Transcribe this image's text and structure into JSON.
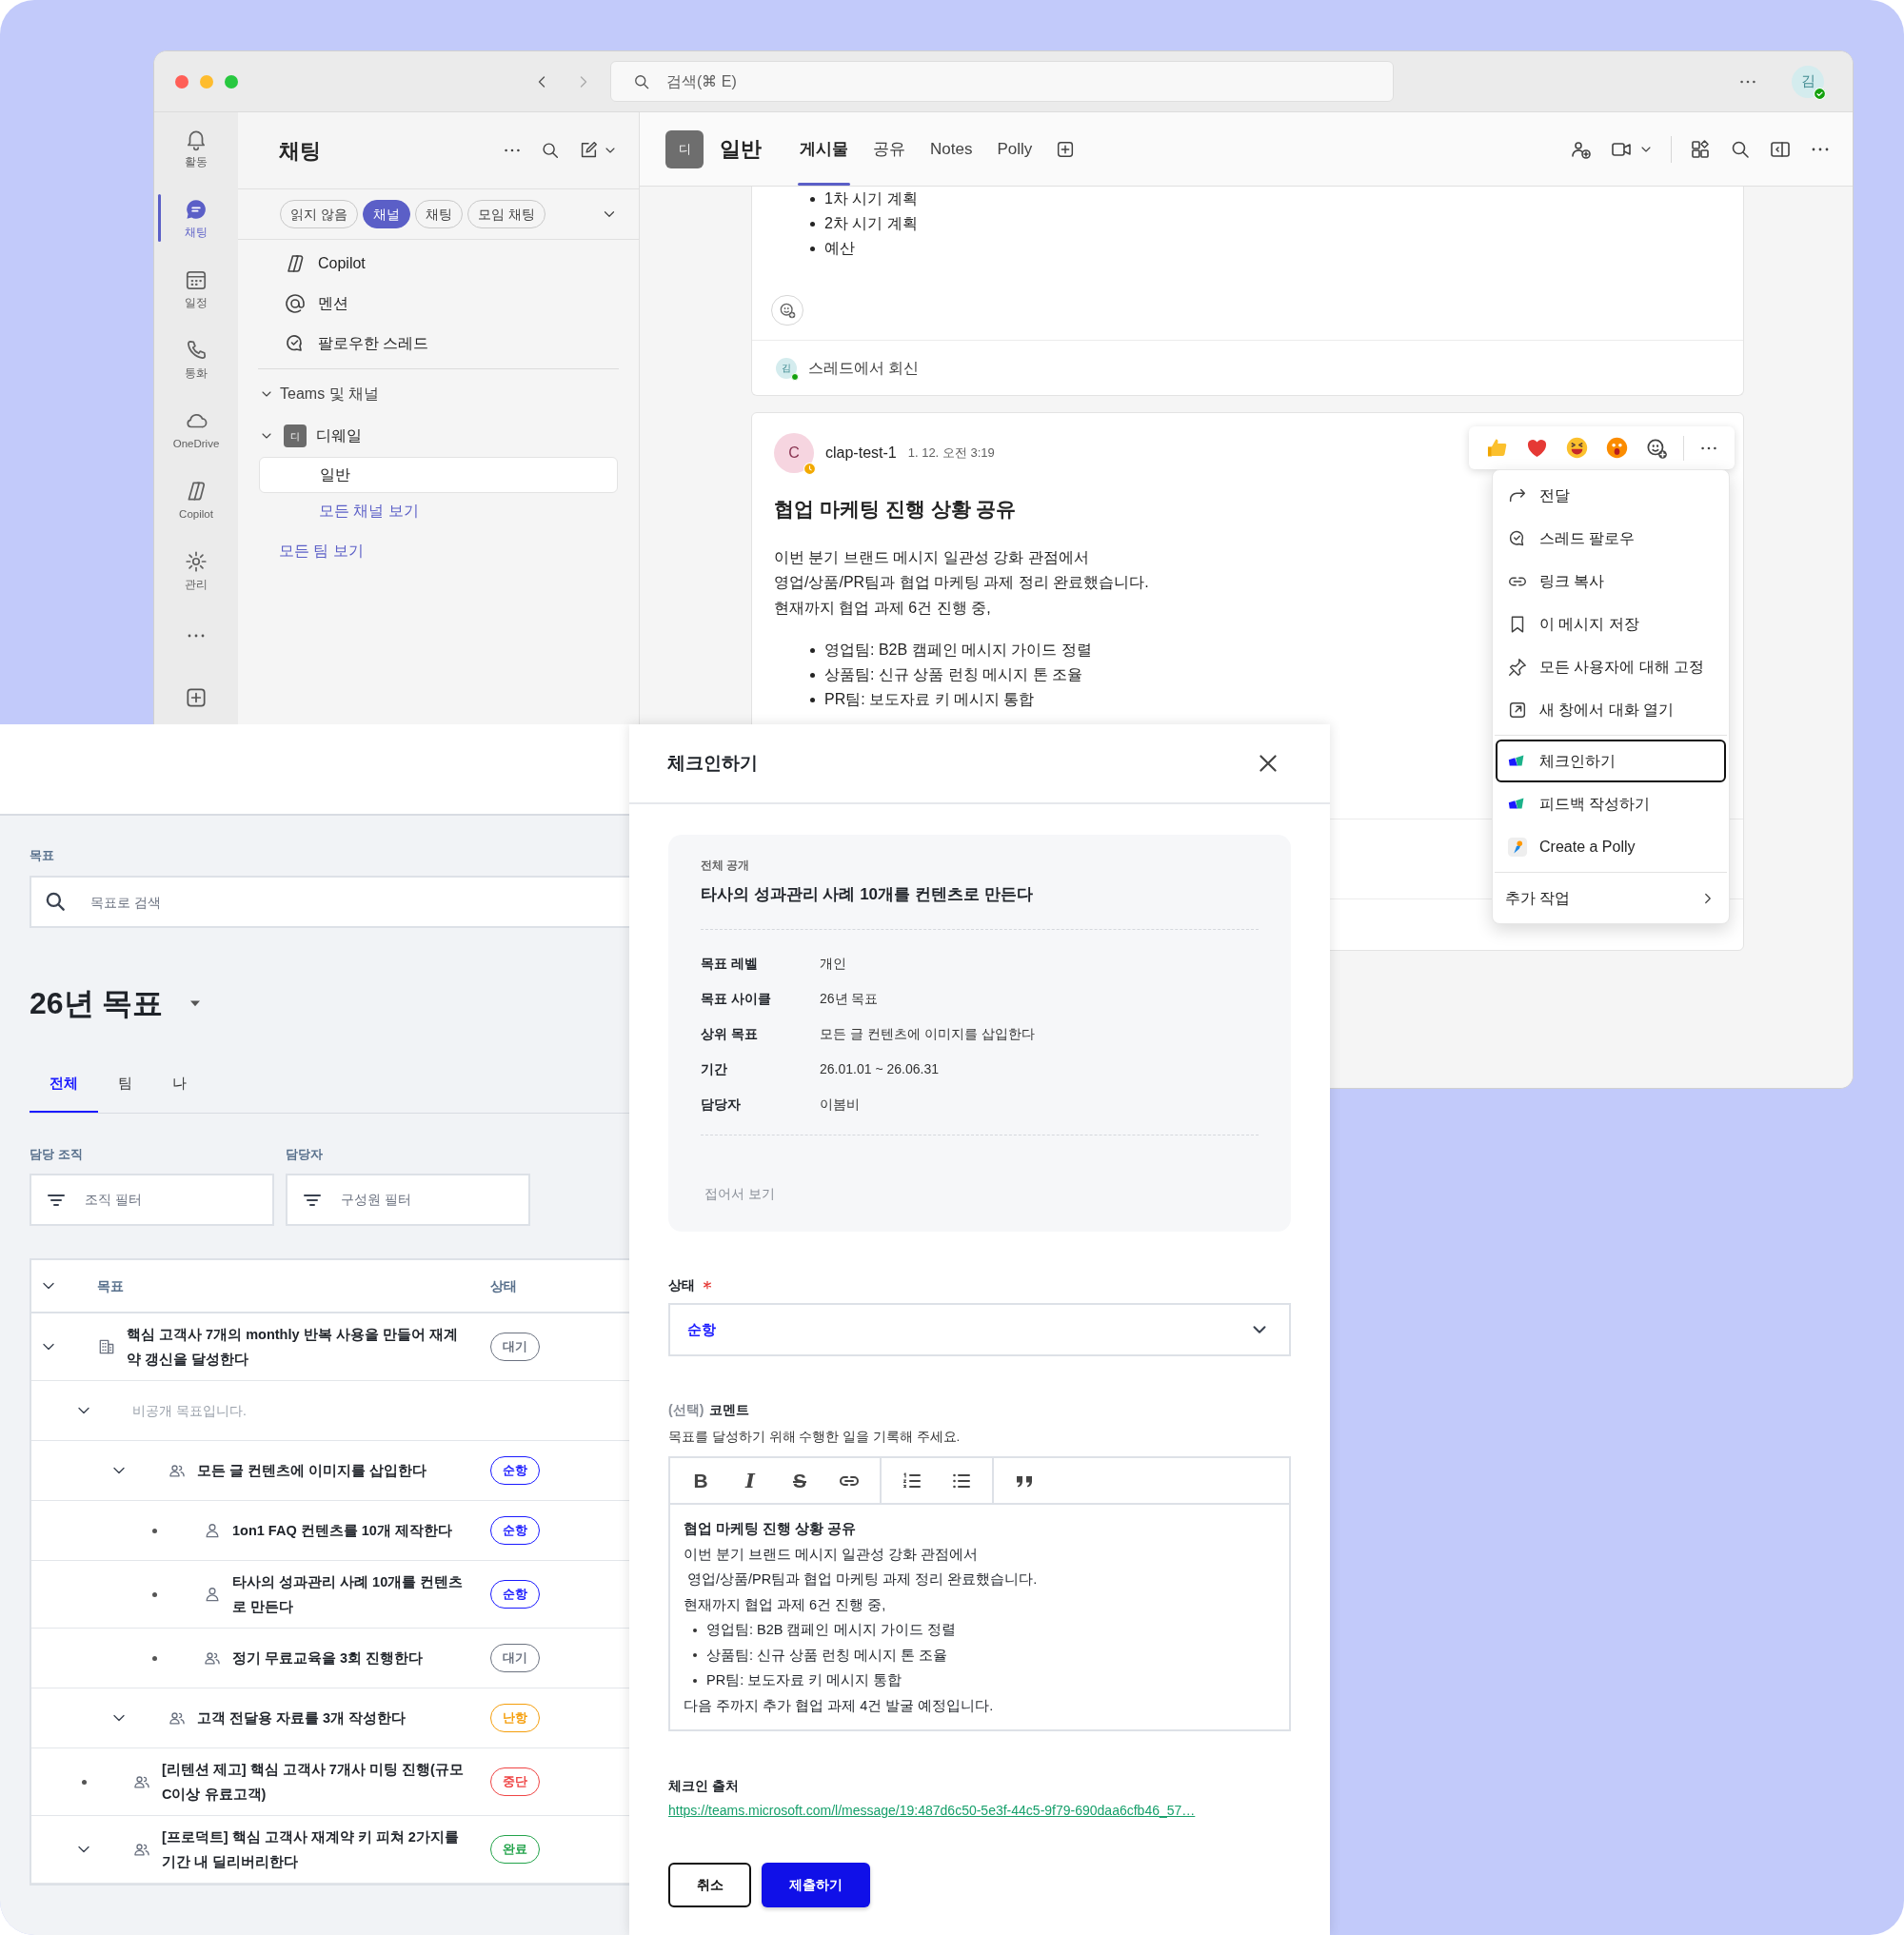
{
  "teams": {
    "search_placeholder": "검색(⌘ E)",
    "user_initial": "김",
    "rail": [
      {
        "label": "활동",
        "selected": false
      },
      {
        "label": "채팅",
        "selected": true
      },
      {
        "label": "일정",
        "selected": false
      },
      {
        "label": "통화",
        "selected": false
      },
      {
        "label": "OneDrive",
        "selected": false
      },
      {
        "label": "Copilot",
        "selected": false
      },
      {
        "label": "관리",
        "selected": false
      }
    ],
    "chat_panel": {
      "title": "채팅",
      "filters": [
        {
          "label": "읽지 않음",
          "selected": false
        },
        {
          "label": "채널",
          "selected": true
        },
        {
          "label": "채팅",
          "selected": false
        },
        {
          "label": "모임 채팅",
          "selected": false
        }
      ],
      "shortcuts": [
        "Copilot",
        "멘션",
        "팔로우한 스레드"
      ],
      "section": {
        "label": "Teams 및 채널",
        "expanded": true
      },
      "team": {
        "initial": "디",
        "name": "디웨일",
        "expanded": true,
        "channels": [
          {
            "label": "일반",
            "selected": true
          }
        ],
        "more_link": "모든 채널 보기"
      },
      "all_teams_link": "모든 팀 보기"
    },
    "channel": {
      "initial": "디",
      "name": "일반",
      "tabs": [
        {
          "label": "게시물",
          "selected": true
        },
        {
          "label": "공유",
          "selected": false
        },
        {
          "label": "Notes",
          "selected": false
        },
        {
          "label": "Polly",
          "selected": false
        }
      ]
    },
    "posts": [
      {
        "kind": "continued",
        "bullets": [
          "1차 시기 계획",
          "2차 시기 계획",
          "예산"
        ],
        "reply": {
          "initial": "김",
          "label": "스레드에서 회신"
        }
      },
      {
        "kind": "full",
        "initial": "C",
        "author": "clap-test-1",
        "time": "1. 12. 오전 3:19",
        "title": "협업 마케팅 진행 상황 공유",
        "body": "이번 분기 브랜드 메시지 일관성 강화 관점에서\n영업/상품/PR팀과 협업 마케팅 과제 정리 완료했습니다.\n현재까지 협업 과제 6건 진행 중,",
        "bullets": [
          "영업팀: B2B 캠페인 메시지 가이드 정렬",
          "상품팀: 신규 상품 런칭 메시지 톤 조율",
          "PR팀: 보도자료 키 메시지 통합"
        ]
      }
    ],
    "context_menu": {
      "groups": [
        [
          {
            "label": "전달",
            "selected": false
          },
          {
            "label": "스레드 팔로우",
            "selected": false
          },
          {
            "label": "링크 복사",
            "selected": false
          },
          {
            "label": "이 메시지 저장",
            "selected": false
          },
          {
            "label": "모든 사용자에 대해 고정",
            "selected": false
          },
          {
            "label": "새 창에서 대화 열기",
            "selected": false
          }
        ],
        [
          {
            "label": "체크인하기",
            "selected": true
          },
          {
            "label": "피드백 작성하기",
            "selected": false
          },
          {
            "label": "Create a Polly",
            "selected": false
          }
        ]
      ],
      "more": "추가 작업"
    }
  },
  "goals": {
    "search_label": "목표",
    "search_placeholder": "목표로 검색",
    "cycle": "26년 목표",
    "tabs": [
      {
        "label": "전체",
        "selected": true
      },
      {
        "label": "팀",
        "selected": false
      },
      {
        "label": "나",
        "selected": false
      }
    ],
    "filters": [
      {
        "label": "담당 조직",
        "placeholder": "조직 필터"
      },
      {
        "label": "담당자",
        "placeholder": "구성원 필터"
      }
    ],
    "table": {
      "columns": [
        "목표",
        "상태"
      ],
      "rows": [
        {
          "kind": "org",
          "expanded": true,
          "title": "핵심 고객사 7개의 monthly 반복 사용을 만들어 재계약 갱신을 달성한다",
          "status": {
            "label": "대기",
            "color": "#6b7280"
          },
          "children": [
            {
              "kind": "private",
              "expanded": true,
              "title": "비공개 목표입니다.",
              "children": [
                {
                  "kind": "team",
                  "expanded": true,
                  "title": "모든 글 컨텐츠에 이미지를 삽입한다",
                  "status": {
                    "label": "순항",
                    "color": "#1a1aff"
                  },
                  "children": [
                    {
                      "kind": "person",
                      "title": "1on1 FAQ 컨텐츠를 10개 제작한다",
                      "status": {
                        "label": "순항",
                        "color": "#1a1aff"
                      }
                    },
                    {
                      "kind": "person",
                      "title": "타사의 성과관리 사례 10개를 컨텐츠로 만든다",
                      "status": {
                        "label": "순항",
                        "color": "#1a1aff"
                      }
                    },
                    {
                      "kind": "team",
                      "title": "정기 무료교육을 3회 진행한다",
                      "status": {
                        "label": "대기",
                        "color": "#6b7280"
                      }
                    }
                  ]
                },
                {
                  "kind": "team",
                  "expanded": true,
                  "title": "고객 전달용 자료를 3개 작성한다",
                  "status": {
                    "label": "난항",
                    "color": "#f59e0b"
                  }
                }
              ]
            },
            {
              "kind": "team",
              "title": "[리텐션 제고] 핵심 고객사 7개사 미팅 진행(규모 C이상 유료고객)",
              "status": {
                "label": "중단",
                "color": "#ef4444"
              }
            },
            {
              "kind": "team",
              "expanded": true,
              "title": "[프로덕트] 핵심 고객사 재계약 키 피쳐 2가지를 기간 내 딜리버리한다",
              "status": {
                "label": "완료",
                "color": "#22a34a"
              }
            }
          ]
        }
      ]
    }
  },
  "dialog": {
    "title": "체크인하기",
    "goal_card": {
      "visibility": "전체 공개",
      "title": "타사의 성과관리 사례 10개를 컨텐츠로 만든다",
      "details": [
        {
          "label": "목표 레벨",
          "value": "개인"
        },
        {
          "label": "목표 사이클",
          "value": "26년 목표"
        },
        {
          "label": "상위 목표",
          "value": "모든 글 컨텐츠에 이미지를 삽입한다"
        },
        {
          "label": "기간",
          "value": "26.01.01 ~ 26.06.31"
        },
        {
          "label": "담당자",
          "value": "이봄비"
        }
      ],
      "collapse": "접어서 보기"
    },
    "status_field": {
      "label": "상태",
      "required": true,
      "value": "순항"
    },
    "comment": {
      "optional_tag": "(선택)",
      "label": "코멘트",
      "hint": "목표를 달성하기 위해 수행한 일을 기록해 주세요.",
      "toolbar": [
        [
          {
            "kind": "bold",
            "glyph": "B"
          },
          {
            "kind": "italic",
            "glyph": "I"
          },
          {
            "kind": "strike",
            "glyph": "S"
          },
          {
            "kind": "link"
          }
        ],
        [
          {
            "kind": "ordered_list"
          },
          {
            "kind": "bullet_list"
          }
        ],
        [
          {
            "kind": "quote"
          }
        ]
      ],
      "content": [
        {
          "kind": "heading",
          "text": "협업 마케팅 진행 상황 공유"
        },
        {
          "kind": "line",
          "text": "이번 분기 브랜드 메시지 일관성 강화 관점에서"
        },
        {
          "kind": "line",
          "text": " 영업/상품/PR팀과 협업 마케팅 과제 정리 완료했습니다."
        },
        {
          "kind": "line",
          "text": "현재까지 협업 과제 6건 진행 중,"
        },
        {
          "kind": "bullet",
          "text": "영업팀: B2B 캠페인 메시지 가이드 정렬"
        },
        {
          "kind": "bullet",
          "text": "상품팀: 신규 상품 런칭 메시지 톤 조율"
        },
        {
          "kind": "bullet",
          "text": "PR팀: 보도자료 키 메시지 통합"
        },
        {
          "kind": "line",
          "text": "다음 주까지 추가 협업 과제 4건 발굴 예정입니다."
        }
      ]
    },
    "source": {
      "label": "체크인 출처",
      "url": "https://teams.microsoft.com/l/message/19:487d6c50-5e3f-44c5-9f79-690daa6cfb46_57…"
    },
    "buttons": [
      {
        "kind": "secondary",
        "label": "취소"
      },
      {
        "kind": "primary",
        "label": "제출하기"
      }
    ]
  }
}
